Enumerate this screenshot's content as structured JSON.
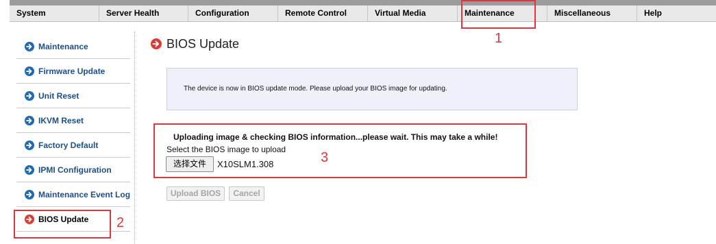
{
  "nav": [
    {
      "label": "System"
    },
    {
      "label": "Server Health"
    },
    {
      "label": "Configuration"
    },
    {
      "label": "Remote Control"
    },
    {
      "label": "Virtual Media"
    },
    {
      "label": "Maintenance"
    },
    {
      "label": "Miscellaneous"
    },
    {
      "label": "Help"
    }
  ],
  "sidebar": {
    "items": [
      {
        "label": "Maintenance"
      },
      {
        "label": "Firmware Update"
      },
      {
        "label": "Unit Reset"
      },
      {
        "label": "IKVM Reset"
      },
      {
        "label": "Factory Default"
      },
      {
        "label": "IPMI Configuration"
      },
      {
        "label": "Maintenance Event Log"
      },
      {
        "label": "BIOS Update"
      }
    ],
    "active_index": 7
  },
  "main": {
    "title": "BIOS Update",
    "info_text": "The device is now in BIOS update mode. Please upload your BIOS image for updating.",
    "upload_message": "Uploading image & checking BIOS information...please wait. This may take a while!",
    "select_label": "Select the BIOS image to upload",
    "file_button_label": "选择文件",
    "file_name": "X10SLM1.308",
    "upload_button_label": "Upload BIOS",
    "cancel_button_label": "Cancel"
  },
  "annotations": [
    "1",
    "2",
    "3"
  ],
  "colors": {
    "link_blue": "#1c4f8a",
    "icon_blue": "#1f6ab4",
    "icon_red": "#e03b2f",
    "annotation_red": "#e0353a"
  },
  "icons": {
    "sidebar_item": "arrow-right-circle-icon",
    "sidebar_active": "arrow-right-circle-icon",
    "title": "arrow-right-circle-icon"
  }
}
